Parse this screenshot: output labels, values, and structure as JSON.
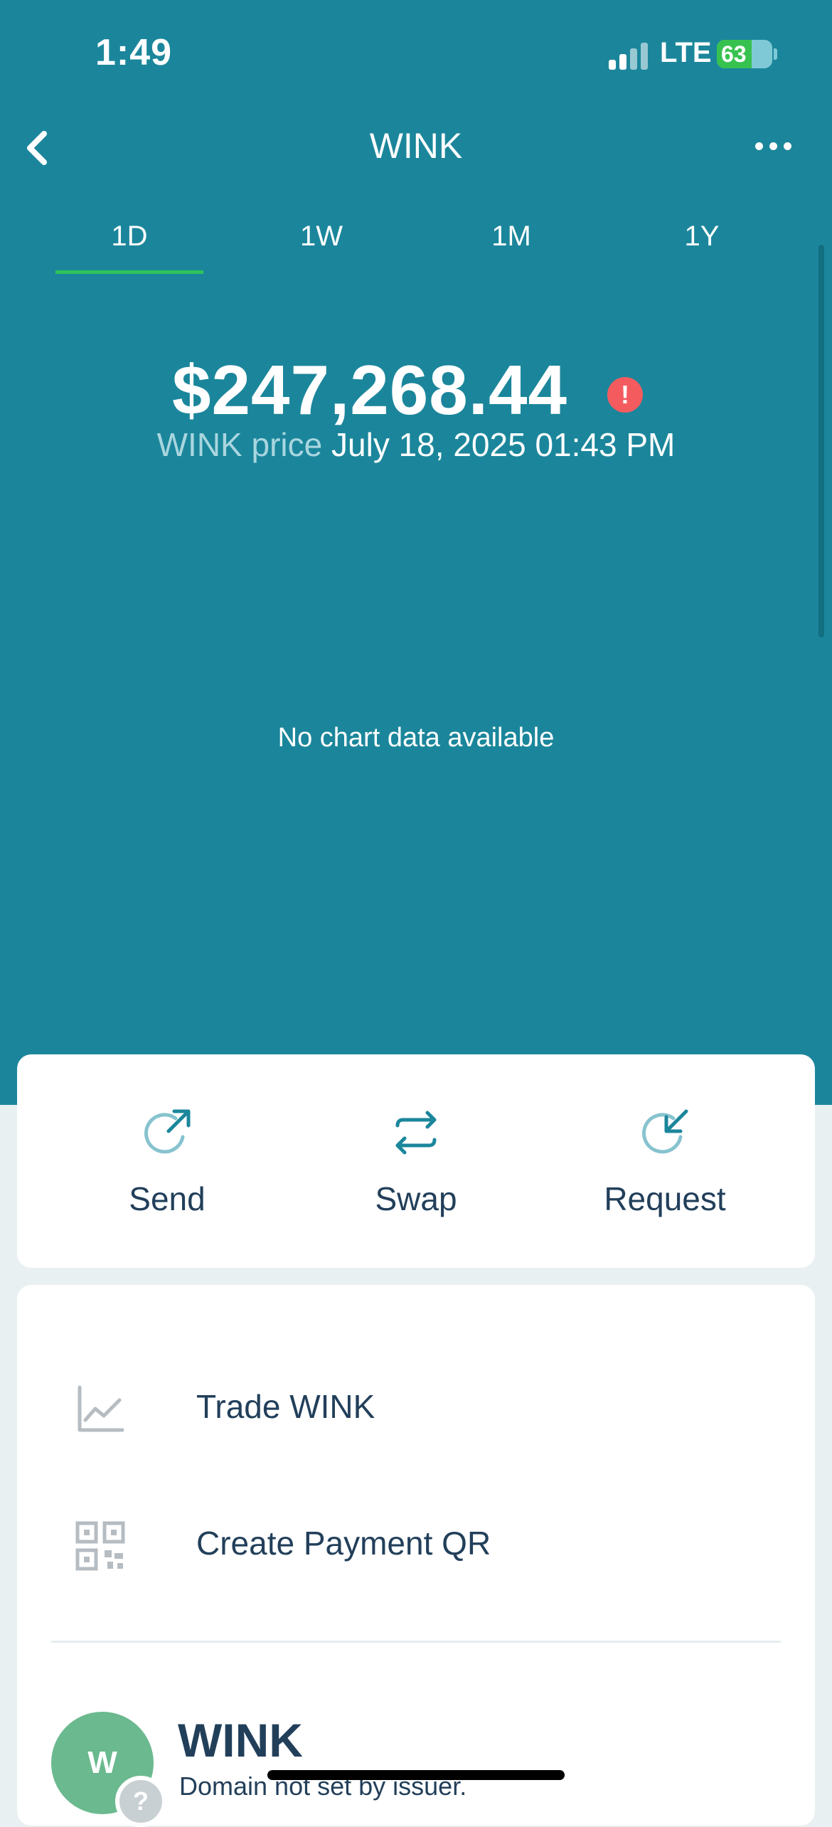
{
  "status_bar": {
    "time": "1:49",
    "network": "LTE",
    "battery": "63",
    "battery_level": 0.63
  },
  "header": {
    "title": "WINK"
  },
  "range_tabs": [
    {
      "label": "1D",
      "selected": true
    },
    {
      "label": "1W",
      "selected": false
    },
    {
      "label": "1M",
      "selected": false
    },
    {
      "label": "1Y",
      "selected": false
    }
  ],
  "price": {
    "value": "$247,268.44",
    "label": "WINK price",
    "timestamp": "July 18, 2025 01:43 PM"
  },
  "chart": {
    "empty_message": "No chart data available"
  },
  "actions": [
    {
      "label": "Send",
      "icon": "send-icon"
    },
    {
      "label": "Swap",
      "icon": "swap-icon"
    },
    {
      "label": "Request",
      "icon": "request-icon"
    }
  ],
  "menu": [
    {
      "label": "Trade WINK",
      "icon": "chart-line-icon"
    },
    {
      "label": "Create Payment QR",
      "icon": "qr-code-icon"
    }
  ],
  "token": {
    "avatar_letter": "W",
    "badge": "?",
    "name": "WINK",
    "domain": "Domain not set by issuer."
  },
  "colors": {
    "primary": "#1b869b",
    "accent": "#2fc25b",
    "warning": "#f45b5f",
    "text_dark": "#223f5a",
    "icon_teal": "#1b869b",
    "icon_light": "#86c3cf"
  }
}
